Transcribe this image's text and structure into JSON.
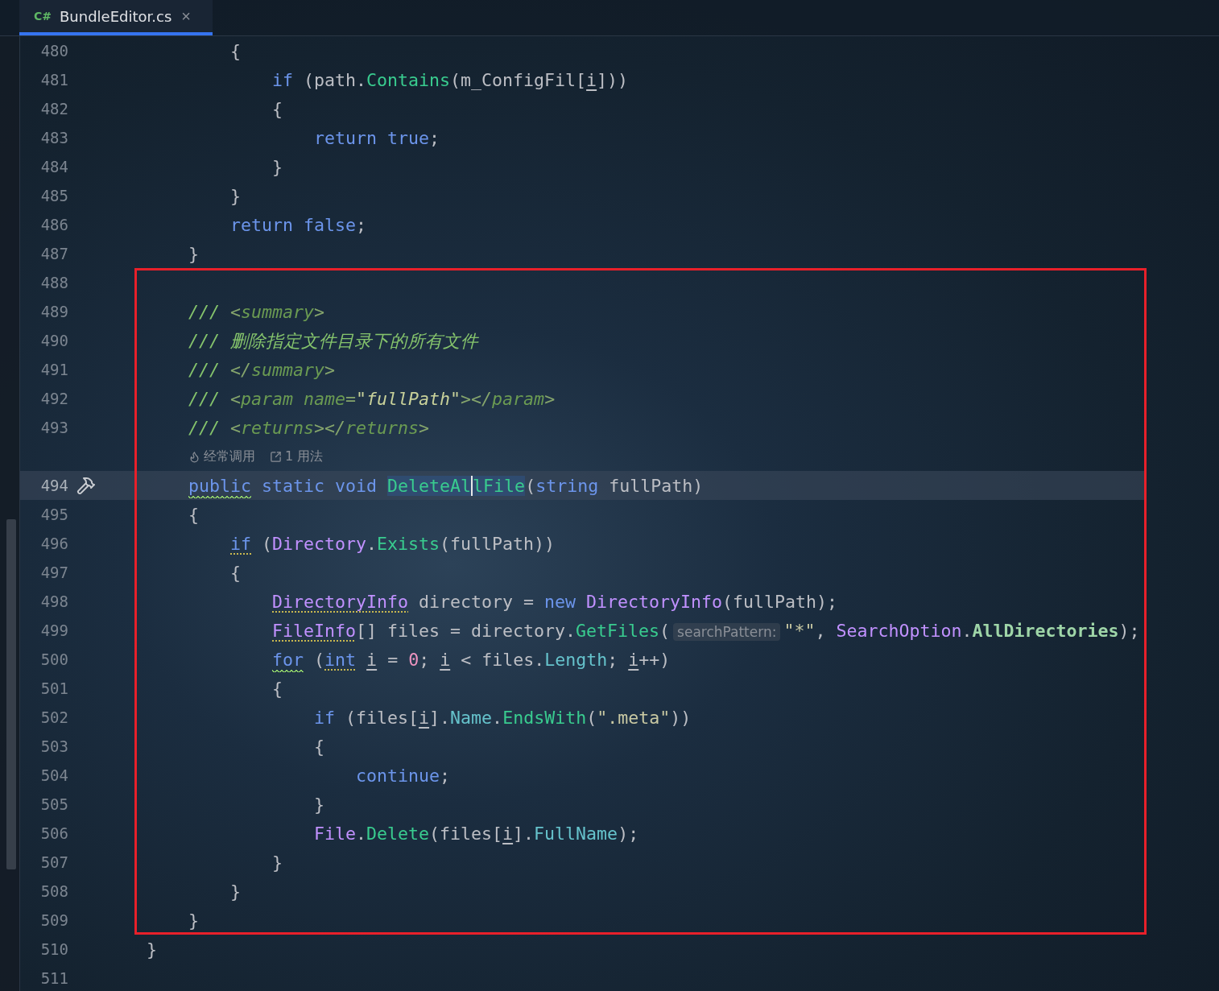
{
  "tab": {
    "language": "C#",
    "title": "BundleEditor.cs",
    "close": "×",
    "selected": true
  },
  "blocks": [
    {
      "highlighted": false,
      "lines": [
        {
          "number": "480",
          "current": false,
          "tokens": [
            {
              "text": "        {",
              "kind": "plain"
            }
          ]
        },
        {
          "number": "481",
          "current": false,
          "tokens": [
            {
              "text": "            if",
              "kind": "keyword"
            },
            {
              "text": " (path.",
              "kind": "plain"
            },
            {
              "text": "Contains",
              "kind": "method"
            },
            {
              "text": "(m_ConfigFil[",
              "kind": "plain"
            },
            {
              "text": "i",
              "kind": "plain",
              "underlined": true
            },
            {
              "text": "]))",
              "kind": "plain"
            }
          ]
        },
        {
          "number": "482",
          "current": false,
          "tokens": [
            {
              "text": "            {",
              "kind": "plain"
            }
          ]
        },
        {
          "number": "483",
          "current": false,
          "tokens": [
            {
              "text": "                return",
              "kind": "keyword"
            },
            {
              "text": " true",
              "kind": "keyword"
            },
            {
              "text": ";",
              "kind": "plain"
            }
          ]
        },
        {
          "number": "484",
          "current": false,
          "tokens": [
            {
              "text": "            }",
              "kind": "plain"
            }
          ]
        },
        {
          "number": "485",
          "current": false,
          "tokens": [
            {
              "text": "        }",
              "kind": "plain"
            }
          ]
        },
        {
          "number": "486",
          "current": false,
          "tokens": [
            {
              "text": "        return",
              "kind": "keyword"
            },
            {
              "text": " false",
              "kind": "keyword"
            },
            {
              "text": ";",
              "kind": "plain"
            }
          ]
        },
        {
          "number": "487",
          "current": false,
          "tokens": [
            {
              "text": "    }",
              "kind": "plain"
            }
          ]
        }
      ]
    },
    {
      "highlighted": true,
      "lines": [
        {
          "number": "488",
          "current": false
        },
        {
          "number": "489",
          "current": false,
          "tokens": [
            {
              "text": "    /// ",
              "kind": "comment"
            },
            {
              "text": "<",
              "kind": "docpunct"
            },
            {
              "text": "summary",
              "kind": "doctag"
            },
            {
              "text": ">",
              "kind": "docpunct"
            }
          ]
        },
        {
          "number": "490",
          "current": false,
          "tokens": [
            {
              "text": "    /// 删除指定文件目录下的所有文件",
              "kind": "comment"
            }
          ]
        },
        {
          "number": "491",
          "current": false,
          "tokens": [
            {
              "text": "    /// ",
              "kind": "comment"
            },
            {
              "text": "</",
              "kind": "docpunct"
            },
            {
              "text": "summary",
              "kind": "doctag"
            },
            {
              "text": ">",
              "kind": "docpunct"
            }
          ]
        },
        {
          "number": "492",
          "current": false,
          "tokens": [
            {
              "text": "    /// ",
              "kind": "comment"
            },
            {
              "text": "<",
              "kind": "docpunct"
            },
            {
              "text": "param name",
              "kind": "doctag"
            },
            {
              "text": "=",
              "kind": "docpunct"
            },
            {
              "text": "\"fullPath\"",
              "kind": "docvalue"
            },
            {
              "text": "></",
              "kind": "docpunct"
            },
            {
              "text": "param",
              "kind": "doctag"
            },
            {
              "text": ">",
              "kind": "docpunct"
            }
          ]
        },
        {
          "number": "493",
          "current": false,
          "tokens": [
            {
              "text": "    /// ",
              "kind": "comment"
            },
            {
              "text": "<",
              "kind": "docpunct"
            },
            {
              "text": "returns",
              "kind": "doctag"
            },
            {
              "text": "></",
              "kind": "docpunct"
            },
            {
              "text": "returns",
              "kind": "doctag"
            },
            {
              "text": ">",
              "kind": "docpunct"
            }
          ]
        },
        {
          "kind": "hints",
          "hints": [
            {
              "kind": "flame",
              "text": "经常调用"
            },
            {
              "kind": "usages",
              "text": "1 用法"
            }
          ]
        },
        {
          "number": "494",
          "current": true,
          "gutter": {
            "kind": "hammer"
          },
          "tokens": [
            {
              "text": "    public",
              "kind": "keyword",
              "wavy": true
            },
            {
              "text": " static",
              "kind": "keyword"
            },
            {
              "text": " void ",
              "kind": "keyword"
            },
            {
              "text": "DeleteAl",
              "kind": "method",
              "marked": true,
              "caret_after": true
            },
            {
              "text": "lFile",
              "kind": "method",
              "marked": true
            },
            {
              "text": "(",
              "kind": "plain"
            },
            {
              "text": "string",
              "kind": "keyword"
            },
            {
              "text": " fullPath)",
              "kind": "plain"
            }
          ]
        },
        {
          "number": "495",
          "current": false,
          "tokens": [
            {
              "text": "    {",
              "kind": "plain"
            }
          ]
        },
        {
          "number": "496",
          "current": false,
          "tokens": [
            {
              "text": "        if",
              "kind": "keyword",
              "dotted": true
            },
            {
              "text": " (",
              "kind": "plain"
            },
            {
              "text": "Directory",
              "kind": "type"
            },
            {
              "text": ".",
              "kind": "plain"
            },
            {
              "text": "Exists",
              "kind": "method"
            },
            {
              "text": "(fullPath))",
              "kind": "plain"
            }
          ]
        },
        {
          "number": "497",
          "current": false,
          "tokens": [
            {
              "text": "        {",
              "kind": "plain"
            }
          ]
        },
        {
          "number": "498",
          "current": false,
          "tokens": [
            {
              "text": "            DirectoryInfo",
              "kind": "type",
              "dotted": true
            },
            {
              "text": " directory = ",
              "kind": "plain"
            },
            {
              "text": "new",
              "kind": "keyword"
            },
            {
              "text": " DirectoryInfo",
              "kind": "type"
            },
            {
              "text": "(fullPath);",
              "kind": "plain"
            }
          ]
        },
        {
          "number": "499",
          "current": false,
          "tokens": [
            {
              "text": "            FileInfo",
              "kind": "type",
              "dotted": true
            },
            {
              "text": "[] files = directory.",
              "kind": "plain"
            },
            {
              "text": "GetFiles",
              "kind": "method"
            },
            {
              "text": "(",
              "kind": "plain"
            },
            {
              "text": "searchPattern:",
              "kind": "hint"
            },
            {
              "text": "\"*\"",
              "kind": "string"
            },
            {
              "text": ", ",
              "kind": "plain"
            },
            {
              "text": "SearchOption",
              "kind": "type"
            },
            {
              "text": ".",
              "kind": "plain"
            },
            {
              "text": "AllDirectories",
              "kind": "enum"
            },
            {
              "text": ");",
              "kind": "plain"
            }
          ]
        },
        {
          "number": "500",
          "current": false,
          "tokens": [
            {
              "text": "            for",
              "kind": "keyword",
              "wavy": true
            },
            {
              "text": " (",
              "kind": "plain"
            },
            {
              "text": "int",
              "kind": "keyword",
              "dotted": true
            },
            {
              "text": " i",
              "kind": "plain",
              "underlined": true
            },
            {
              "text": " = ",
              "kind": "plain"
            },
            {
              "text": "0",
              "kind": "number"
            },
            {
              "text": "; ",
              "kind": "plain"
            },
            {
              "text": "i",
              "kind": "plain",
              "underlined": true
            },
            {
              "text": " < files.",
              "kind": "plain"
            },
            {
              "text": "Length",
              "kind": "property"
            },
            {
              "text": "; ",
              "kind": "plain"
            },
            {
              "text": "i",
              "kind": "plain",
              "underlined": true
            },
            {
              "text": "++)",
              "kind": "plain"
            }
          ]
        },
        {
          "number": "501",
          "current": false,
          "tokens": [
            {
              "text": "            {",
              "kind": "plain"
            }
          ]
        },
        {
          "number": "502",
          "current": false,
          "tokens": [
            {
              "text": "                if",
              "kind": "keyword"
            },
            {
              "text": " (files[",
              "kind": "plain"
            },
            {
              "text": "i",
              "kind": "plain",
              "underlined": true
            },
            {
              "text": "].",
              "kind": "plain"
            },
            {
              "text": "Name",
              "kind": "property"
            },
            {
              "text": ".",
              "kind": "plain"
            },
            {
              "text": "EndsWith",
              "kind": "method"
            },
            {
              "text": "(",
              "kind": "plain"
            },
            {
              "text": "\".meta\"",
              "kind": "string"
            },
            {
              "text": "))",
              "kind": "plain"
            }
          ]
        },
        {
          "number": "503",
          "current": false,
          "tokens": [
            {
              "text": "                {",
              "kind": "plain"
            }
          ]
        },
        {
          "number": "504",
          "current": false,
          "tokens": [
            {
              "text": "                    continue",
              "kind": "keyword"
            },
            {
              "text": ";",
              "kind": "plain"
            }
          ]
        },
        {
          "number": "505",
          "current": false,
          "tokens": [
            {
              "text": "                }",
              "kind": "plain"
            }
          ]
        },
        {
          "number": "506",
          "current": false,
          "tokens": [
            {
              "text": "                File",
              "kind": "type"
            },
            {
              "text": ".",
              "kind": "plain"
            },
            {
              "text": "Delete",
              "kind": "method"
            },
            {
              "text": "(files[",
              "kind": "plain"
            },
            {
              "text": "i",
              "kind": "plain",
              "underlined": true
            },
            {
              "text": "].",
              "kind": "plain"
            },
            {
              "text": "FullName",
              "kind": "property"
            },
            {
              "text": ");",
              "kind": "plain"
            }
          ]
        },
        {
          "number": "507",
          "current": false,
          "tokens": [
            {
              "text": "            }",
              "kind": "plain"
            }
          ]
        },
        {
          "number": "508",
          "current": false,
          "tokens": [
            {
              "text": "        }",
              "kind": "plain"
            }
          ]
        },
        {
          "number": "509",
          "current": false,
          "tokens": [
            {
              "text": "    }",
              "kind": "plain"
            }
          ]
        }
      ]
    },
    {
      "highlighted": false,
      "lines": [
        {
          "number": "510",
          "current": false,
          "tokens": [
            {
              "text": "}",
              "kind": "plain"
            }
          ]
        },
        {
          "number": "511",
          "current": false
        }
      ]
    }
  ]
}
